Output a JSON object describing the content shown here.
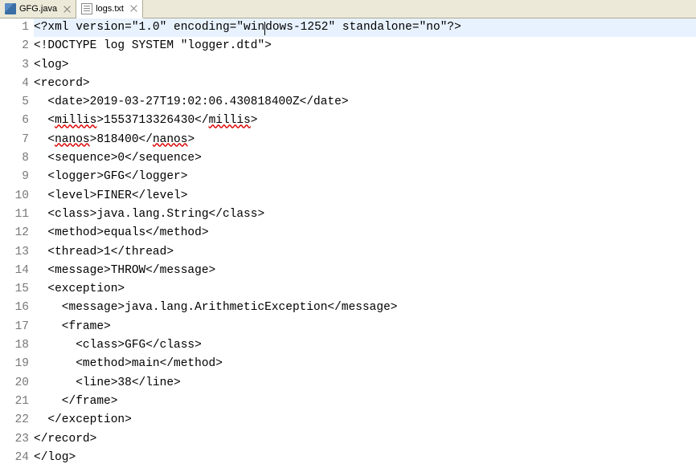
{
  "tabs": [
    {
      "label": "GFG.java",
      "type": "java",
      "active": false
    },
    {
      "label": "logs.txt",
      "type": "txt",
      "active": true
    }
  ],
  "current_line": 1,
  "cursor_col_in_line1_after": "win",
  "lines": [
    {
      "num": 1,
      "indent": 0,
      "content": [
        {
          "t": "<?xml version=\"1.0\" encoding=\""
        },
        {
          "t": "win",
          "u": false
        },
        {
          "t": "dows",
          "u": false
        },
        {
          "t": "-1252\" standalone=\"no\"?>"
        }
      ]
    },
    {
      "num": 2,
      "indent": 0,
      "content": [
        {
          "t": "<!DOCTYPE log SYSTEM \"logger.dtd\">"
        }
      ]
    },
    {
      "num": 3,
      "indent": 0,
      "content": [
        {
          "t": "<log>"
        }
      ]
    },
    {
      "num": 4,
      "indent": 0,
      "content": [
        {
          "t": "<record>"
        }
      ]
    },
    {
      "num": 5,
      "indent": 1,
      "content": [
        {
          "t": "<date>2019-03-27T19:02:06.430818400Z</date>"
        }
      ]
    },
    {
      "num": 6,
      "indent": 1,
      "content": [
        {
          "t": "<"
        },
        {
          "t": "millis",
          "u": true
        },
        {
          "t": ">1553713326430</"
        },
        {
          "t": "millis",
          "u": true
        },
        {
          "t": ">"
        }
      ]
    },
    {
      "num": 7,
      "indent": 1,
      "content": [
        {
          "t": "<"
        },
        {
          "t": "nanos",
          "u": true
        },
        {
          "t": ">818400</"
        },
        {
          "t": "nanos",
          "u": true
        },
        {
          "t": ">"
        }
      ]
    },
    {
      "num": 8,
      "indent": 1,
      "content": [
        {
          "t": "<sequence>0</sequence>"
        }
      ]
    },
    {
      "num": 9,
      "indent": 1,
      "content": [
        {
          "t": "<logger>GFG</logger>"
        }
      ]
    },
    {
      "num": 10,
      "indent": 1,
      "content": [
        {
          "t": "<level>FINER</level>"
        }
      ]
    },
    {
      "num": 11,
      "indent": 1,
      "content": [
        {
          "t": "<class>java.lang.String</class>"
        }
      ]
    },
    {
      "num": 12,
      "indent": 1,
      "content": [
        {
          "t": "<method>equals</method>"
        }
      ]
    },
    {
      "num": 13,
      "indent": 1,
      "content": [
        {
          "t": "<thread>1</thread>"
        }
      ]
    },
    {
      "num": 14,
      "indent": 1,
      "content": [
        {
          "t": "<message>THROW</message>"
        }
      ]
    },
    {
      "num": 15,
      "indent": 1,
      "content": [
        {
          "t": "<exception>"
        }
      ]
    },
    {
      "num": 16,
      "indent": 2,
      "content": [
        {
          "t": "<message>java.lang.ArithmeticException</message>"
        }
      ]
    },
    {
      "num": 17,
      "indent": 2,
      "content": [
        {
          "t": "<frame>"
        }
      ]
    },
    {
      "num": 18,
      "indent": 3,
      "content": [
        {
          "t": "<class>GFG</class>"
        }
      ]
    },
    {
      "num": 19,
      "indent": 3,
      "content": [
        {
          "t": "<method>main</method>"
        }
      ]
    },
    {
      "num": 20,
      "indent": 3,
      "content": [
        {
          "t": "<line>38</line>"
        }
      ]
    },
    {
      "num": 21,
      "indent": 2,
      "content": [
        {
          "t": "</frame>"
        }
      ]
    },
    {
      "num": 22,
      "indent": 1,
      "content": [
        {
          "t": "</exception>"
        }
      ]
    },
    {
      "num": 23,
      "indent": 0,
      "content": [
        {
          "t": "</record>"
        }
      ]
    },
    {
      "num": 24,
      "indent": 0,
      "content": [
        {
          "t": "</log>"
        }
      ]
    }
  ]
}
